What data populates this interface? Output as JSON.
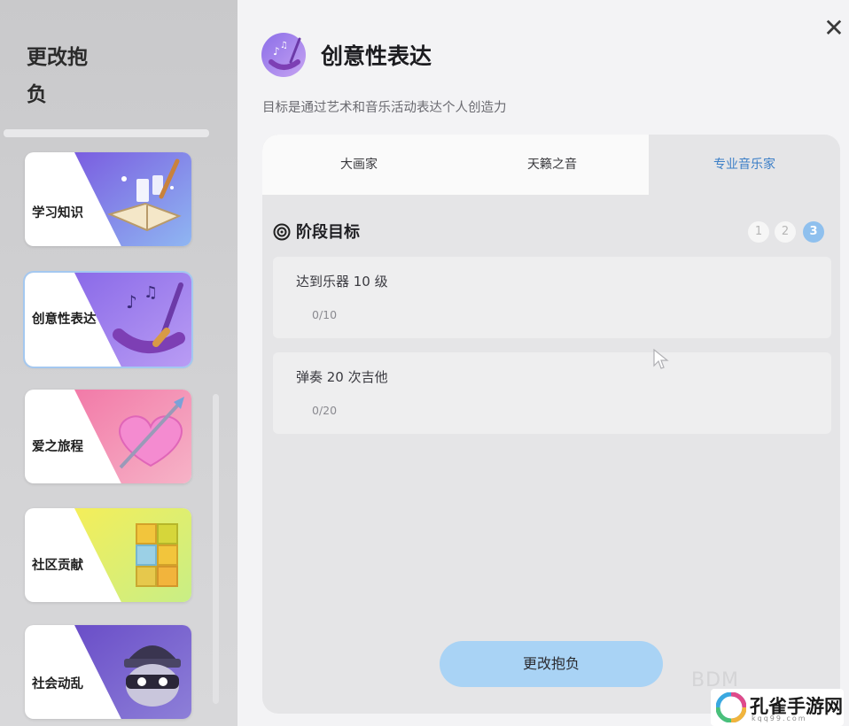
{
  "sidebar": {
    "title": "更改抱负",
    "items": [
      {
        "label": "学习知识",
        "icon": "book-quill-icon"
      },
      {
        "label": "创意性表达",
        "icon": "music-paint-icon"
      },
      {
        "label": "爱之旅程",
        "icon": "heart-arrow-icon"
      },
      {
        "label": "社区贡献",
        "icon": "blocks-icon"
      },
      {
        "label": "社会动乱",
        "icon": "burglar-mask-icon"
      }
    ],
    "selected_index": 1
  },
  "header": {
    "title": "创意性表达",
    "subtitle": "目标是通过艺术和音乐活动表达个人创造力",
    "close_label": "✕"
  },
  "tabs": [
    {
      "label": "大画家"
    },
    {
      "label": "天籁之音"
    },
    {
      "label": "专业音乐家"
    }
  ],
  "active_tab": 2,
  "stage": {
    "title": "阶段目标",
    "steps": [
      "1",
      "2",
      "3"
    ],
    "current_step": 3
  },
  "goals": [
    {
      "name": "达到乐器 10 级",
      "progress": "0/10"
    },
    {
      "name": "弹奏 20 次吉他",
      "progress": "0/20"
    }
  ],
  "actions": {
    "change_button": "更改抱负"
  },
  "watermark": "BDM",
  "logo": {
    "name": "孔雀手游网",
    "sub": "kqq99.com"
  },
  "colors": {
    "accent": "#3c7fc7",
    "button": "#a9d3f5",
    "step_active": "#8fc0ee",
    "selected_outline": "#a4c8f0"
  }
}
